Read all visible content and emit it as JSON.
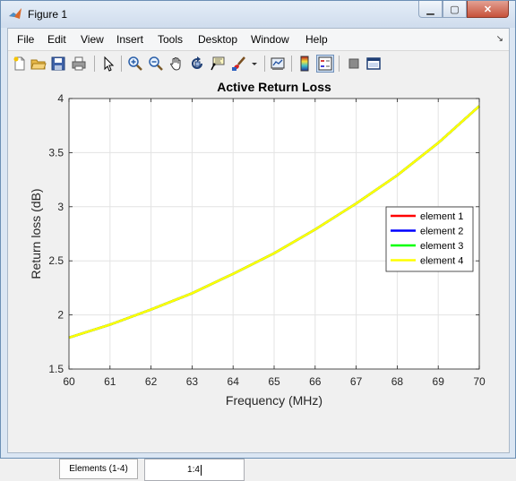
{
  "window": {
    "title": "Figure 1"
  },
  "window_controls": {
    "minimize": "▁",
    "maximize": "▢",
    "close": "✕"
  },
  "menu": [
    "File",
    "Edit",
    "View",
    "Insert",
    "Tools",
    "Desktop",
    "Window",
    "Help"
  ],
  "menu_dock_arrow": "↘",
  "toolbar": [
    "new-figure-icon",
    "open-folder-icon",
    "save-icon",
    "print-icon",
    "arrow-pointer-icon",
    "zoom-in-icon",
    "zoom-out-icon",
    "pan-hand-icon",
    "rotate-3d-icon",
    "data-cursor-icon",
    "brush-icon",
    "brush-dropdown-icon",
    "link-plot-icon",
    "insert-colorbar-icon",
    "insert-legend-icon",
    "hide-plot-tools-icon",
    "show-plot-tools-icon"
  ],
  "controls": {
    "elements_button": "Elements (1-4)",
    "elements_edit": "1:4"
  },
  "chart_data": {
    "type": "line",
    "title": "Active Return Loss",
    "xlabel": "Frequency (MHz)",
    "ylabel": "Return loss (dB)",
    "xlim": [
      60,
      70
    ],
    "ylim": [
      1.5,
      4
    ],
    "xticks": [
      "60",
      "61",
      "62",
      "63",
      "64",
      "65",
      "66",
      "67",
      "68",
      "69",
      "70"
    ],
    "yticks": [
      "1.5",
      "2",
      "2.5",
      "3",
      "3.5",
      "4"
    ],
    "grid": true,
    "legend_position": "right",
    "x": [
      60,
      61,
      62,
      63,
      64,
      65,
      66,
      67,
      68,
      69,
      70
    ],
    "series": [
      {
        "name": "element 1",
        "color": "#ff0000",
        "values": [
          1.79,
          1.91,
          2.05,
          2.2,
          2.38,
          2.57,
          2.79,
          3.03,
          3.29,
          3.59,
          3.93
        ]
      },
      {
        "name": "element 2",
        "color": "#0000ff",
        "values": [
          1.79,
          1.91,
          2.05,
          2.2,
          2.38,
          2.57,
          2.79,
          3.03,
          3.29,
          3.59,
          3.93
        ]
      },
      {
        "name": "element 3",
        "color": "#00ff00",
        "values": [
          1.79,
          1.91,
          2.05,
          2.2,
          2.38,
          2.57,
          2.79,
          3.03,
          3.29,
          3.59,
          3.93
        ]
      },
      {
        "name": "element 4",
        "color": "#ffff00",
        "values": [
          1.79,
          1.91,
          2.05,
          2.2,
          2.38,
          2.57,
          2.79,
          3.03,
          3.29,
          3.59,
          3.93
        ]
      }
    ]
  }
}
